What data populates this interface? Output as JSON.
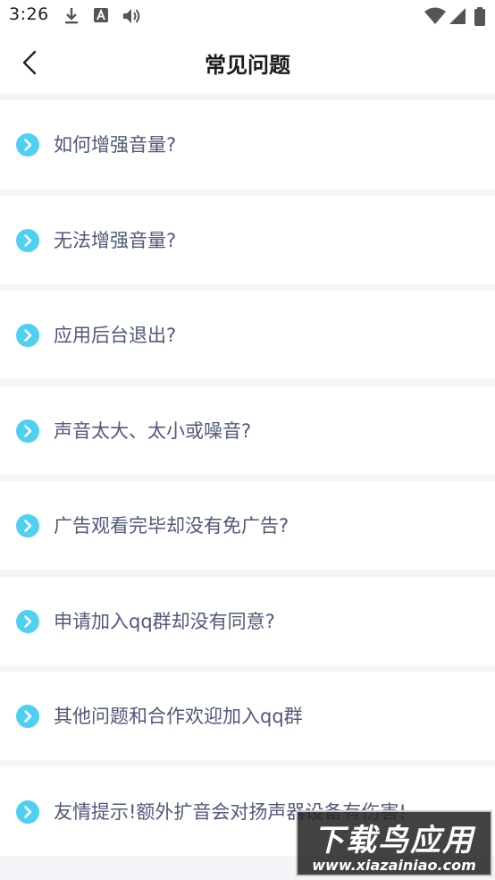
{
  "status_bar": {
    "time": "3:26"
  },
  "nav": {
    "title": "常见问题"
  },
  "faq": {
    "items": [
      {
        "label": "如何增强音量?"
      },
      {
        "label": "无法增强音量?"
      },
      {
        "label": "应用后台退出?"
      },
      {
        "label": "声音太大、太小或噪音?"
      },
      {
        "label": "广告观看完毕却没有免广告?"
      },
      {
        "label": "申请加入qq群却没有同意?"
      },
      {
        "label": "其他问题和合作欢迎加入qq群"
      },
      {
        "label": "友情提示!额外扩音会对扬声器设备有伤害!"
      }
    ]
  },
  "watermark": {
    "title": "下载鸟应用",
    "url": "www.xiazainiao.com"
  },
  "colors": {
    "accent": "#4fd0f2",
    "label": "#4f5a79",
    "background": "#f3f5f9"
  }
}
